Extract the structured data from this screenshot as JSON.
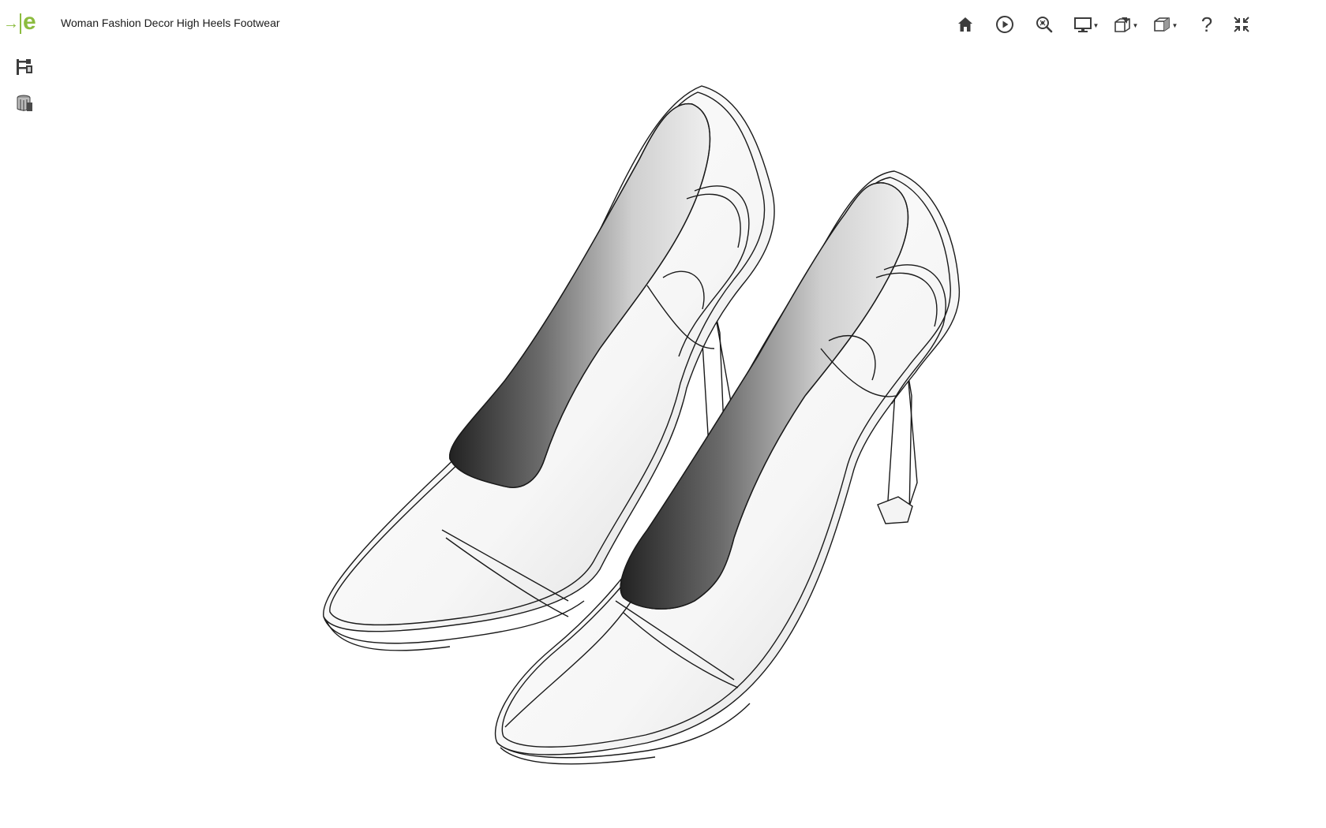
{
  "app": {
    "logo_arrow": "→",
    "logo_letter": "e",
    "title": "Woman Fashion Decor High Heels Footwear"
  },
  "toolbar": {
    "items": [
      {
        "name": "home-icon",
        "has_dropdown": false
      },
      {
        "name": "play-icon",
        "has_dropdown": false
      },
      {
        "name": "zoom-search-icon",
        "has_dropdown": false
      },
      {
        "name": "display-monitor-icon",
        "has_dropdown": true
      },
      {
        "name": "section-view-icon",
        "has_dropdown": true
      },
      {
        "name": "view-cube-icon",
        "has_dropdown": true
      },
      {
        "name": "help-icon",
        "has_dropdown": false
      },
      {
        "name": "fullscreen-icon",
        "has_dropdown": false
      }
    ],
    "help_glyph": "?",
    "caret_glyph": "▼"
  },
  "sidebar": {
    "items": [
      {
        "name": "feature-tree-icon"
      },
      {
        "name": "configurations-icon"
      }
    ]
  },
  "viewport": {
    "model": "high-heel-pumps-pair",
    "render_style": "shaded-with-edges",
    "colors": {
      "edge": "#1a1a1a",
      "shade_dark": "#3a3a3a",
      "shade_light": "#f2f2f2"
    }
  },
  "colors": {
    "brand": "#8cbc3f",
    "icon": "#3c3c3c",
    "background": "#ffffff"
  }
}
